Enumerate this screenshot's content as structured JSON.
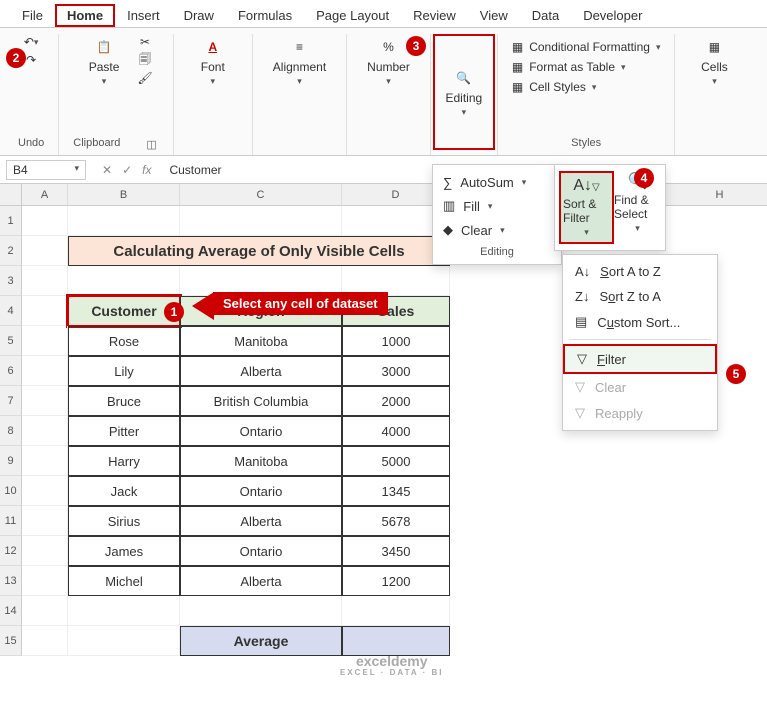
{
  "tabs": [
    "File",
    "Home",
    "Insert",
    "Draw",
    "Formulas",
    "Page Layout",
    "Review",
    "View",
    "Data",
    "Developer"
  ],
  "active_tab": "Home",
  "ribbon": {
    "undo": "Undo",
    "clipboard": "Clipboard",
    "paste": "Paste",
    "font": "Font",
    "alignment": "Alignment",
    "number": "Number",
    "editing": "Editing",
    "styles": "Styles",
    "cells": "Cells",
    "cond_fmt": "Conditional Formatting",
    "fmt_table": "Format as Table",
    "cell_styles": "Cell Styles"
  },
  "namebox": "B4",
  "formula_value": "Customer",
  "editing_menu": {
    "autosum": "AutoSum",
    "fill": "Fill",
    "clear": "Clear",
    "label": "Editing"
  },
  "sort_filter": {
    "sf": "Sort & Filter",
    "fs": "Find & Select"
  },
  "ctx": {
    "sort_az": "Sort A to Z",
    "sort_za": "Sort Z to A",
    "custom": "Custom Sort...",
    "filter": "Filter",
    "clear": "Clear",
    "reapply": "Reapply"
  },
  "columns": [
    "A",
    "B",
    "C",
    "D",
    "H"
  ],
  "title": "Calculating Average of Only Visible Cells",
  "tip": "Select any cell of dataset",
  "headers": [
    "Customer",
    "Region",
    "Sales"
  ],
  "rows": [
    {
      "c": "Rose",
      "r": "Manitoba",
      "s": "1000"
    },
    {
      "c": "Lily",
      "r": "Alberta",
      "s": "3000"
    },
    {
      "c": "Bruce",
      "r": "British Columbia",
      "s": "2000"
    },
    {
      "c": "Pitter",
      "r": "Ontario",
      "s": "4000"
    },
    {
      "c": "Harry",
      "r": "Manitoba",
      "s": "5000"
    },
    {
      "c": "Jack",
      "r": "Ontario",
      "s": "1345"
    },
    {
      "c": "Sirius",
      "r": "Alberta",
      "s": "5678"
    },
    {
      "c": "James",
      "r": "Ontario",
      "s": "3450"
    },
    {
      "c": "Michel",
      "r": "Alberta",
      "s": "1200"
    }
  ],
  "average": "Average",
  "callouts": {
    "1": "1",
    "2": "2",
    "3": "3",
    "4": "4",
    "5": "5"
  },
  "watermark1": "exceldemy",
  "watermark2": "EXCEL · DATA · BI"
}
